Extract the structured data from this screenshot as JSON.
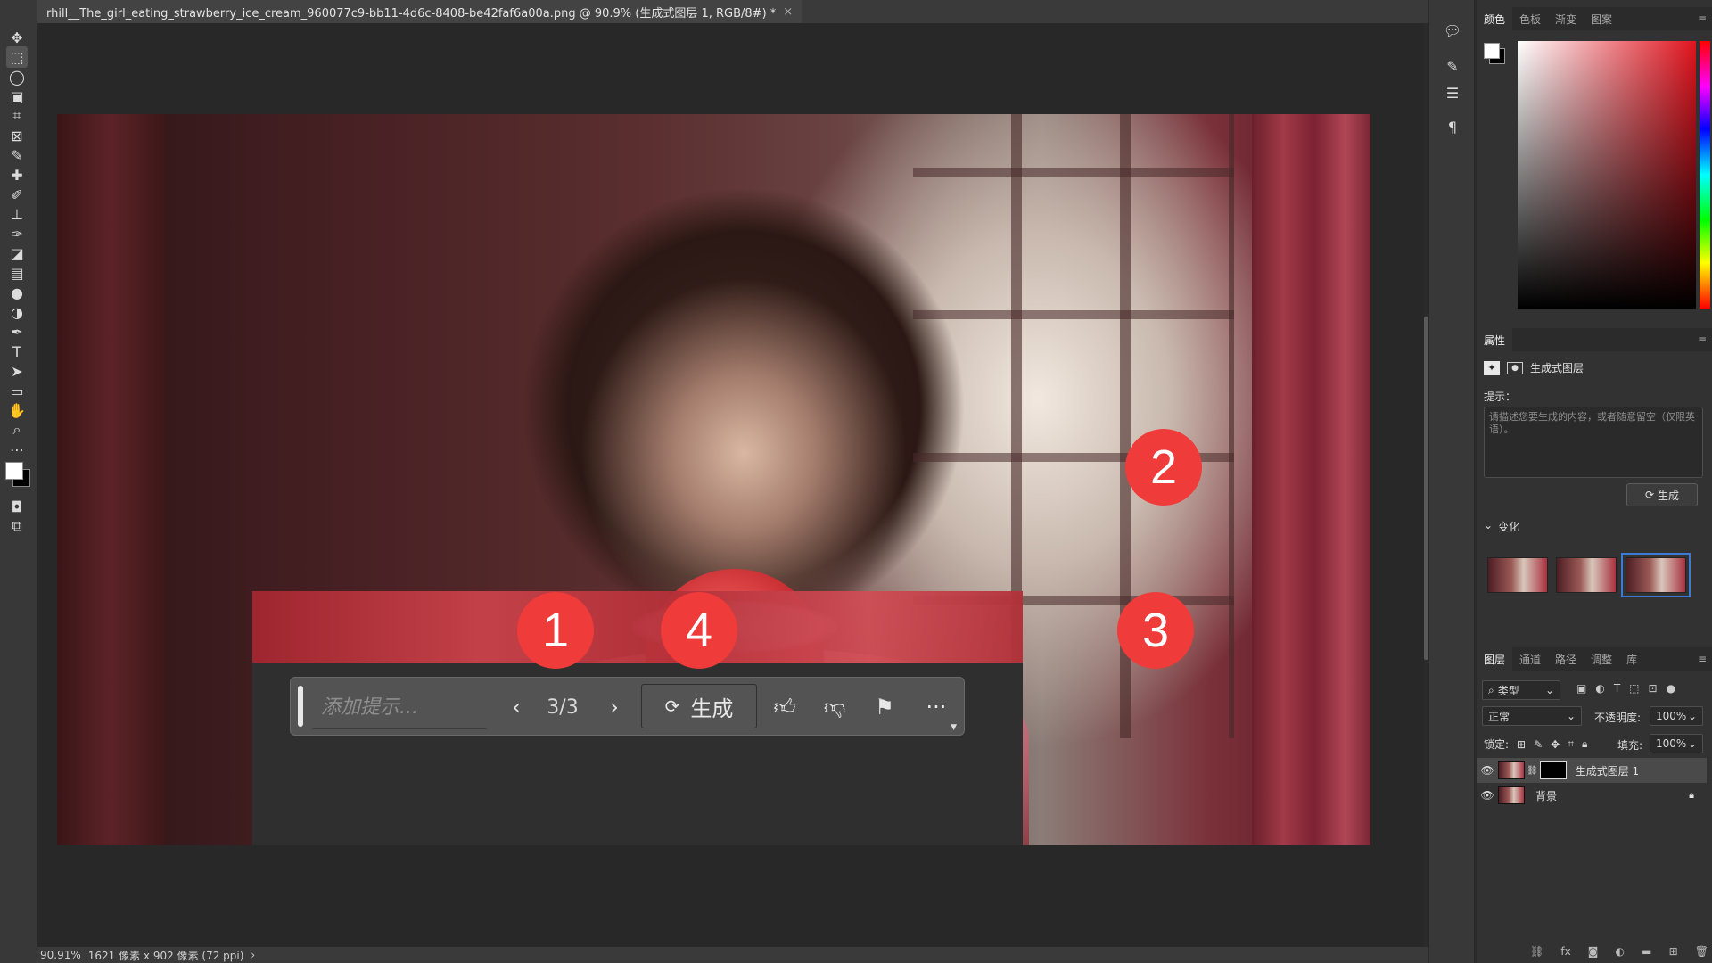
{
  "document": {
    "tab_title": "rhill__The_girl_eating_strawberry_ice_cream_960077c9-bb11-4d6c-8408-be42faf6a00a.png @ 90.9% (生成式图层 1, RGB/8#) *",
    "close_glyph": "×"
  },
  "status": {
    "zoom": "90.91%",
    "dimensions": "1621 像素 x 902 像素 (72 ppi)",
    "caret": "›"
  },
  "taskbar": {
    "prompt_placeholder": "添加提示...",
    "counter": "3/3",
    "generate_label": "生成",
    "more_glyph": "···"
  },
  "callouts": [
    "1",
    "2",
    "3",
    "4"
  ],
  "panels": {
    "color_tabs": [
      "颜色",
      "色板",
      "渐变",
      "图案"
    ],
    "properties_tab": "属性",
    "layer_type": "生成式图层",
    "prompt_label": "提示：",
    "prompt_placeholder": "请描述您要生成的内容，或者随意留空（仅限英语）。",
    "generate_label": "生成",
    "variations_label": "变化",
    "layers_tabs": [
      "图层",
      "通道",
      "路径",
      "调整",
      "库"
    ],
    "filter_label": "类型",
    "blend_mode": "正常",
    "opacity_label": "不透明度:",
    "opacity_value": "100%",
    "lock_label": "锁定:",
    "fill_label": "填充:",
    "fill_value": "100%",
    "layers": [
      {
        "name": "生成式图层 1",
        "selected": true
      },
      {
        "name": "背景",
        "selected": false
      }
    ]
  },
  "colors": {
    "callout": "#ef3b39",
    "selection_accent": "#3b7bd6"
  }
}
